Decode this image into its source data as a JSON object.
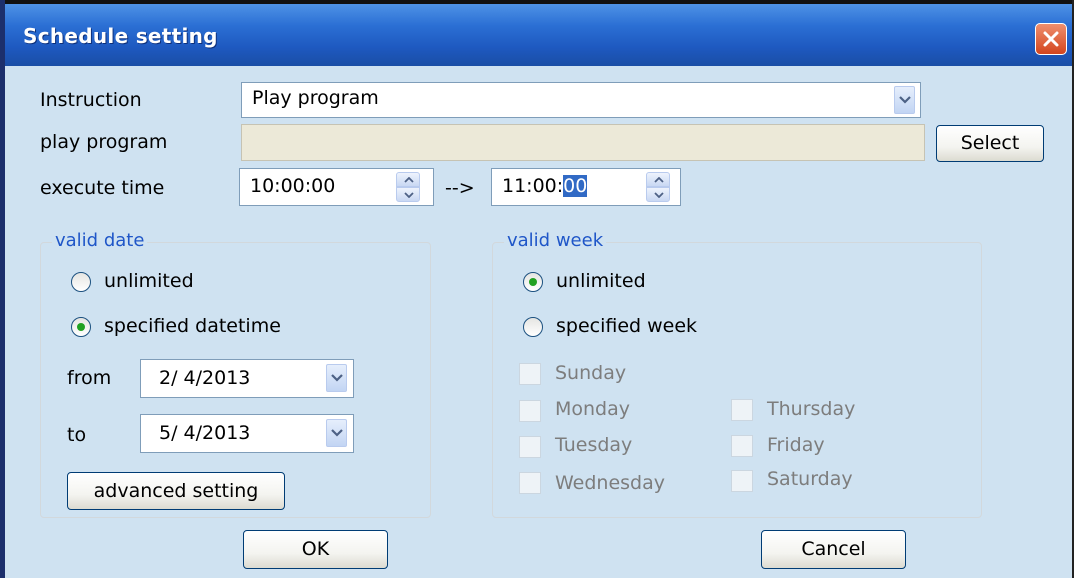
{
  "window": {
    "title": "Schedule setting"
  },
  "instruction": {
    "label": "Instruction",
    "value": "Play program"
  },
  "play_program": {
    "label": "play program",
    "value": "",
    "select_label": "Select"
  },
  "execute_time": {
    "label": "execute time",
    "start": "10:00:00",
    "arrow": "-->",
    "end_prefix": "11:00:",
    "end_selected": "00"
  },
  "valid_date": {
    "title": "valid date",
    "unlimited_label": "unlimited",
    "specified_label": "specified datetime",
    "selected": "specified datetime",
    "from_label": "from",
    "from_value": "2/ 4/2013",
    "to_label": "to",
    "to_value": "5/ 4/2013",
    "advanced_label": "advanced setting"
  },
  "valid_week": {
    "title": "valid week",
    "unlimited_label": "unlimited",
    "specified_label": "specified week",
    "selected": "unlimited",
    "days": [
      "Sunday",
      "Monday",
      "Tuesday",
      "Wednesday",
      "Thursday",
      "Friday",
      "Saturday"
    ]
  },
  "footer": {
    "ok_label": "OK",
    "cancel_label": "Cancel"
  },
  "colors": {
    "titlebar": "#2b6fd4",
    "dialog_bg": "#cfe2f1",
    "group_title": "#1f56c8",
    "close_button": "#d3451e"
  }
}
